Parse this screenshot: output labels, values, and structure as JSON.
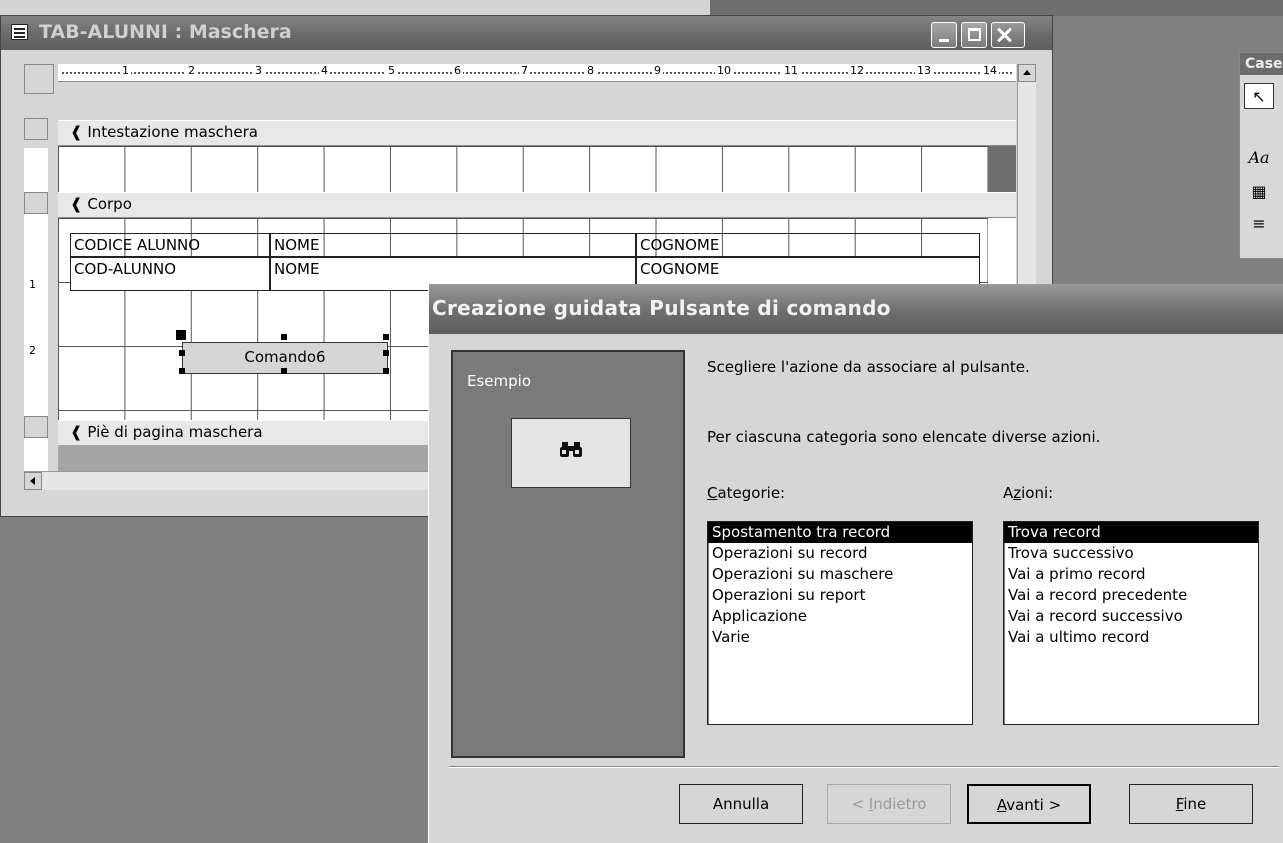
{
  "form_window": {
    "title": "TAB-ALUNNI : Maschera",
    "ruler_marks": [
      "1",
      "2",
      "3",
      "4",
      "5",
      "6",
      "7",
      "8",
      "9",
      "10",
      "11",
      "12",
      "13",
      "14"
    ],
    "vruler_marks": [
      "1",
      "2"
    ],
    "sections": {
      "header": "Intestazione maschera",
      "body": "Corpo",
      "footer": "Piè di pagina maschera"
    },
    "labels": {
      "codice": "CODICE ALUNNO",
      "nome": "NOME",
      "cognome": "COGNOME"
    },
    "fields": {
      "cod": "COD-ALUNNO",
      "nome": "NOME",
      "cognome": "COGNOME"
    },
    "command_button": "Comando6"
  },
  "toolbox": {
    "title": "Casella strumenti",
    "title_visible": "Case",
    "tools": [
      "pointer-icon",
      "label-tool-icon",
      "form-icon",
      "list-icon"
    ],
    "label_glyph": "Aa"
  },
  "wizard": {
    "title": "Creazione guidata Pulsante di comando",
    "example_label": "Esempio",
    "example_icon": "binoculars-icon",
    "prompt": "Scegliere l'azione da associare al pulsante.",
    "info": "Per ciascuna categoria sono elencate diverse azioni.",
    "categories_label": {
      "accel": "C",
      "rest": "ategorie:"
    },
    "actions_label": {
      "pre": "A",
      "accel": "z",
      "rest": "ioni:"
    },
    "categories": [
      "Spostamento tra record",
      "Operazioni su record",
      "Operazioni su maschere",
      "Operazioni su report",
      "Applicazione",
      "Varie"
    ],
    "selected_category": "Spostamento tra record",
    "actions": [
      "Trova record",
      "Trova successivo",
      "Vai a primo record",
      "Vai a record precedente",
      "Vai a record successivo",
      "Vai a ultimo record"
    ],
    "selected_action": "Trova record",
    "buttons": {
      "cancel": "Annulla",
      "back": {
        "pre": "< ",
        "accel": "I",
        "rest": "ndietro"
      },
      "next": {
        "accel": "A",
        "rest": "vanti >"
      },
      "finish": {
        "accel": "F",
        "rest": "ine"
      }
    }
  },
  "colors": {
    "titlebar": "#6c6c6c",
    "selection": "#000000",
    "dialog": "#d6d6d6"
  }
}
